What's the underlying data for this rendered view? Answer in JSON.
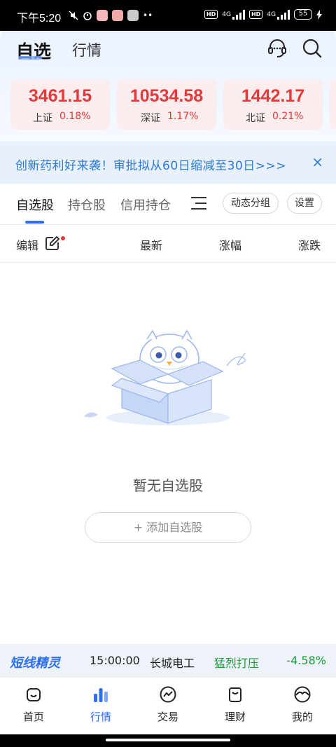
{
  "status_bar": {
    "time": "下午5:20",
    "network_1": "4G",
    "network_2": "4G",
    "hd_1": "HD",
    "hd_2": "HD",
    "battery": "55"
  },
  "header": {
    "tabs": [
      {
        "label": "自选",
        "active": true
      },
      {
        "label": "行情",
        "active": false
      }
    ],
    "icons": [
      "customer-service-icon",
      "search-icon"
    ]
  },
  "indices": [
    {
      "value": "3461.15",
      "name": "上证",
      "change": "0.18%"
    },
    {
      "value": "10534.58",
      "name": "深证",
      "change": "1.17%"
    },
    {
      "value": "1442.17",
      "name": "北证",
      "change": "0.21%"
    }
  ],
  "banner": {
    "text": "创新药利好来袭！审批拟从60日缩减至30日>>>",
    "close": "×"
  },
  "sub_tabs": {
    "items": [
      {
        "label": "自选股",
        "active": true
      },
      {
        "label": "持仓股",
        "active": false
      },
      {
        "label": "信用持仓",
        "active": false
      }
    ],
    "group_button": "动态分组",
    "settings_button": "设置"
  },
  "columns": {
    "edit": "编辑",
    "latest": "最新",
    "change_pct": "涨幅",
    "change_amt": "涨跌"
  },
  "empty_state": {
    "message": "暂无自选股",
    "add_button": "+ 添加自选股"
  },
  "ticker": {
    "logo": "短线精灵",
    "time": "15:00:00",
    "stock": "长城电工",
    "signal": "猛烈打压",
    "change": "-4.58%"
  },
  "bottom_nav": [
    {
      "label": "首页",
      "icon": "home-icon",
      "active": false
    },
    {
      "label": "行情",
      "icon": "market-icon",
      "active": true
    },
    {
      "label": "交易",
      "icon": "trade-icon",
      "active": false
    },
    {
      "label": "理财",
      "icon": "wealth-icon",
      "active": false
    },
    {
      "label": "我的",
      "icon": "profile-icon",
      "active": false
    }
  ],
  "colors": {
    "up": "#e23a3a",
    "down": "#1d9a3a",
    "accent": "#2e6ff2",
    "banner_text": "#2b7ad8"
  }
}
